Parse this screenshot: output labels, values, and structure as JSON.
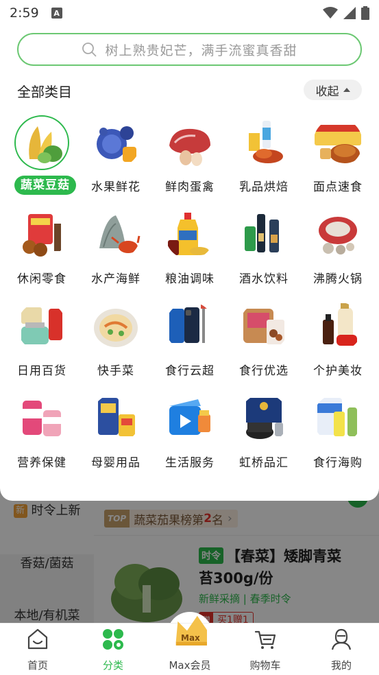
{
  "status_bar": {
    "time": "2:59",
    "notif_icon": "A"
  },
  "search": {
    "placeholder": "树上熟贵妃芒，满手流蜜真香甜"
  },
  "panel": {
    "title": "全部类目",
    "collapse_label": "收起",
    "categories": [
      {
        "label": "蔬菜豆菇",
        "active": true
      },
      {
        "label": "水果鲜花"
      },
      {
        "label": "鲜肉蛋禽"
      },
      {
        "label": "乳品烘焙"
      },
      {
        "label": "面点速食"
      },
      {
        "label": "休闲零食"
      },
      {
        "label": "水产海鲜"
      },
      {
        "label": "粮油调味"
      },
      {
        "label": "酒水饮料"
      },
      {
        "label": "沸腾火锅"
      },
      {
        "label": "日用百货"
      },
      {
        "label": "快手菜"
      },
      {
        "label": "食行云超"
      },
      {
        "label": "食行优选"
      },
      {
        "label": "个护美妆"
      },
      {
        "label": "营养保健"
      },
      {
        "label": "母婴用品"
      },
      {
        "label": "生活服务"
      },
      {
        "label": "虹桥品汇"
      },
      {
        "label": "食行海购"
      }
    ]
  },
  "background": {
    "sidebar": {
      "new_tag": "新",
      "items": [
        "时令上新",
        "香菇/菌菇",
        "本地/有机菜"
      ]
    },
    "rank": {
      "top": "TOP",
      "prefix": "蔬菜茄果榜第",
      "num": "2",
      "suffix": "名"
    },
    "product": {
      "tag": "时令",
      "title1": "【春菜】矮脚青菜",
      "title2": "苔300g/份",
      "subtitle": "新鲜采摘 | 春季时令",
      "promo_icon": "赠",
      "promo": "买1赠1"
    }
  },
  "bottom_nav": {
    "items": [
      {
        "label": "首页"
      },
      {
        "label": "分类",
        "active": true
      },
      {
        "label": "Max会员",
        "badge": "Max"
      },
      {
        "label": "购物车"
      },
      {
        "label": "我的"
      }
    ]
  },
  "colors": {
    "accent": "#2db94d",
    "search_border": "#6cc873",
    "promo": "#e5312b"
  }
}
